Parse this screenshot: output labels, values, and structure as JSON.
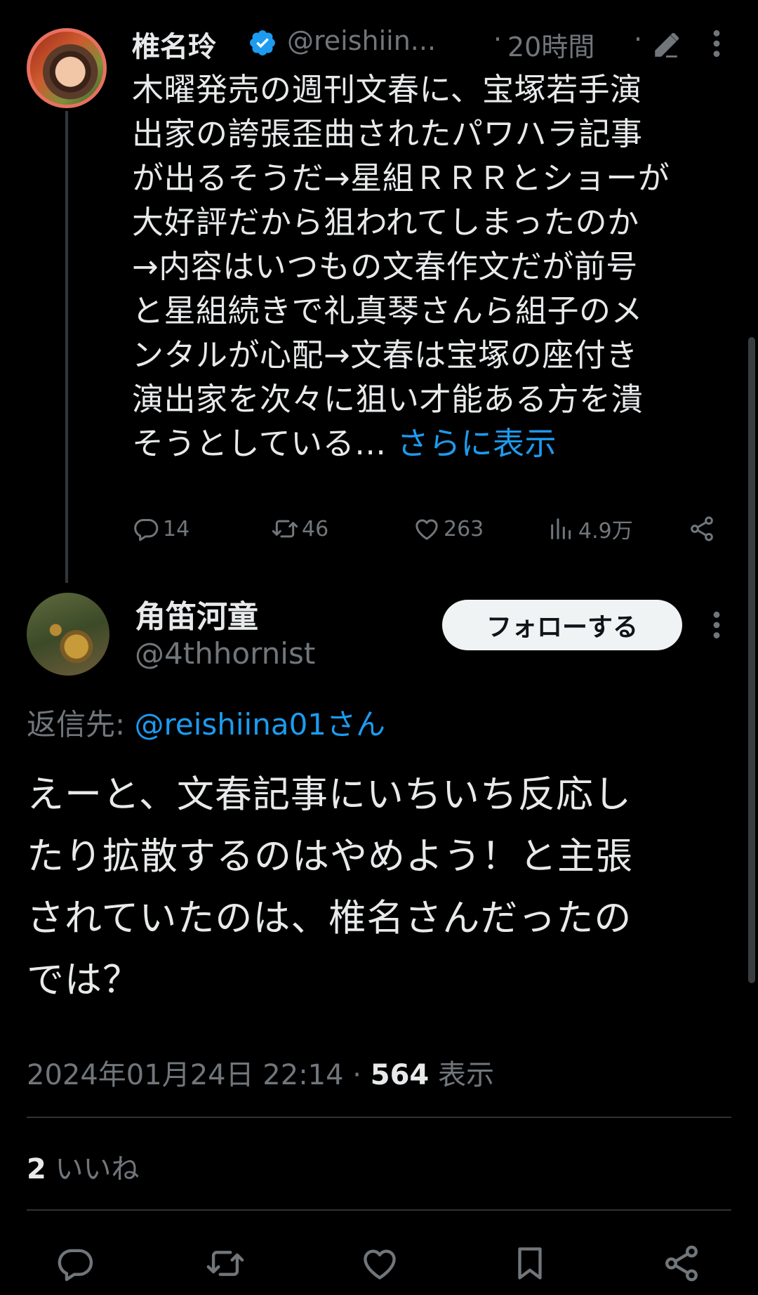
{
  "parent_tweet": {
    "author_name": "椎名玲",
    "handle": "@reishiin...",
    "separator": "·",
    "time": "20時間",
    "text": "木曜発売の週刊文春に、宝塚若手演\n出家の誇張歪曲されたパワハラ記事\nが出るそうだ→星組ＲＲＲとショーが\n大好評だから狙われてしまったのか\n→内容はいつもの文春作文だが前号\nと星組続きで礼真琴さんら組子のメ\nンタルが心配→文春は宝塚の座付き\n演出家を次々に狙い才能ある方を潰\nそうとしている… ",
    "show_more": "さらに表示",
    "stats": {
      "replies": "14",
      "retweets": "46",
      "likes": "263",
      "views": "4.9万"
    }
  },
  "reply_tweet": {
    "author_name": "角笛河童",
    "handle": "@4thhornist",
    "follow_label": "フォローする",
    "reply_to_label": "返信先: ",
    "reply_to_mention": "@reishiina01さん",
    "text": "えーと、文春記事にいちいち反応し\nたり拡散するのはやめよう！と主張\nされていたのは、椎名さんだったの\nでは？",
    "timestamp": "2024年01月24日 22:14",
    "separator": " · ",
    "views_count": "564",
    "views_label": " 表示",
    "likes_count": "2",
    "likes_label": " いいね"
  },
  "icons": {
    "verified": "verified-badge-icon",
    "edit": "edit-pencil-icon",
    "more": "more-vertical-icon",
    "reply": "reply-icon",
    "retweet": "retweet-icon",
    "like": "heart-icon",
    "views": "views-chart-icon",
    "share": "share-icon",
    "bookmark": "bookmark-icon"
  },
  "colors": {
    "background": "#000000",
    "text": "#e7e9ea",
    "muted": "#71767b",
    "link": "#1d9bf0",
    "verified": "#1d9bf0"
  }
}
